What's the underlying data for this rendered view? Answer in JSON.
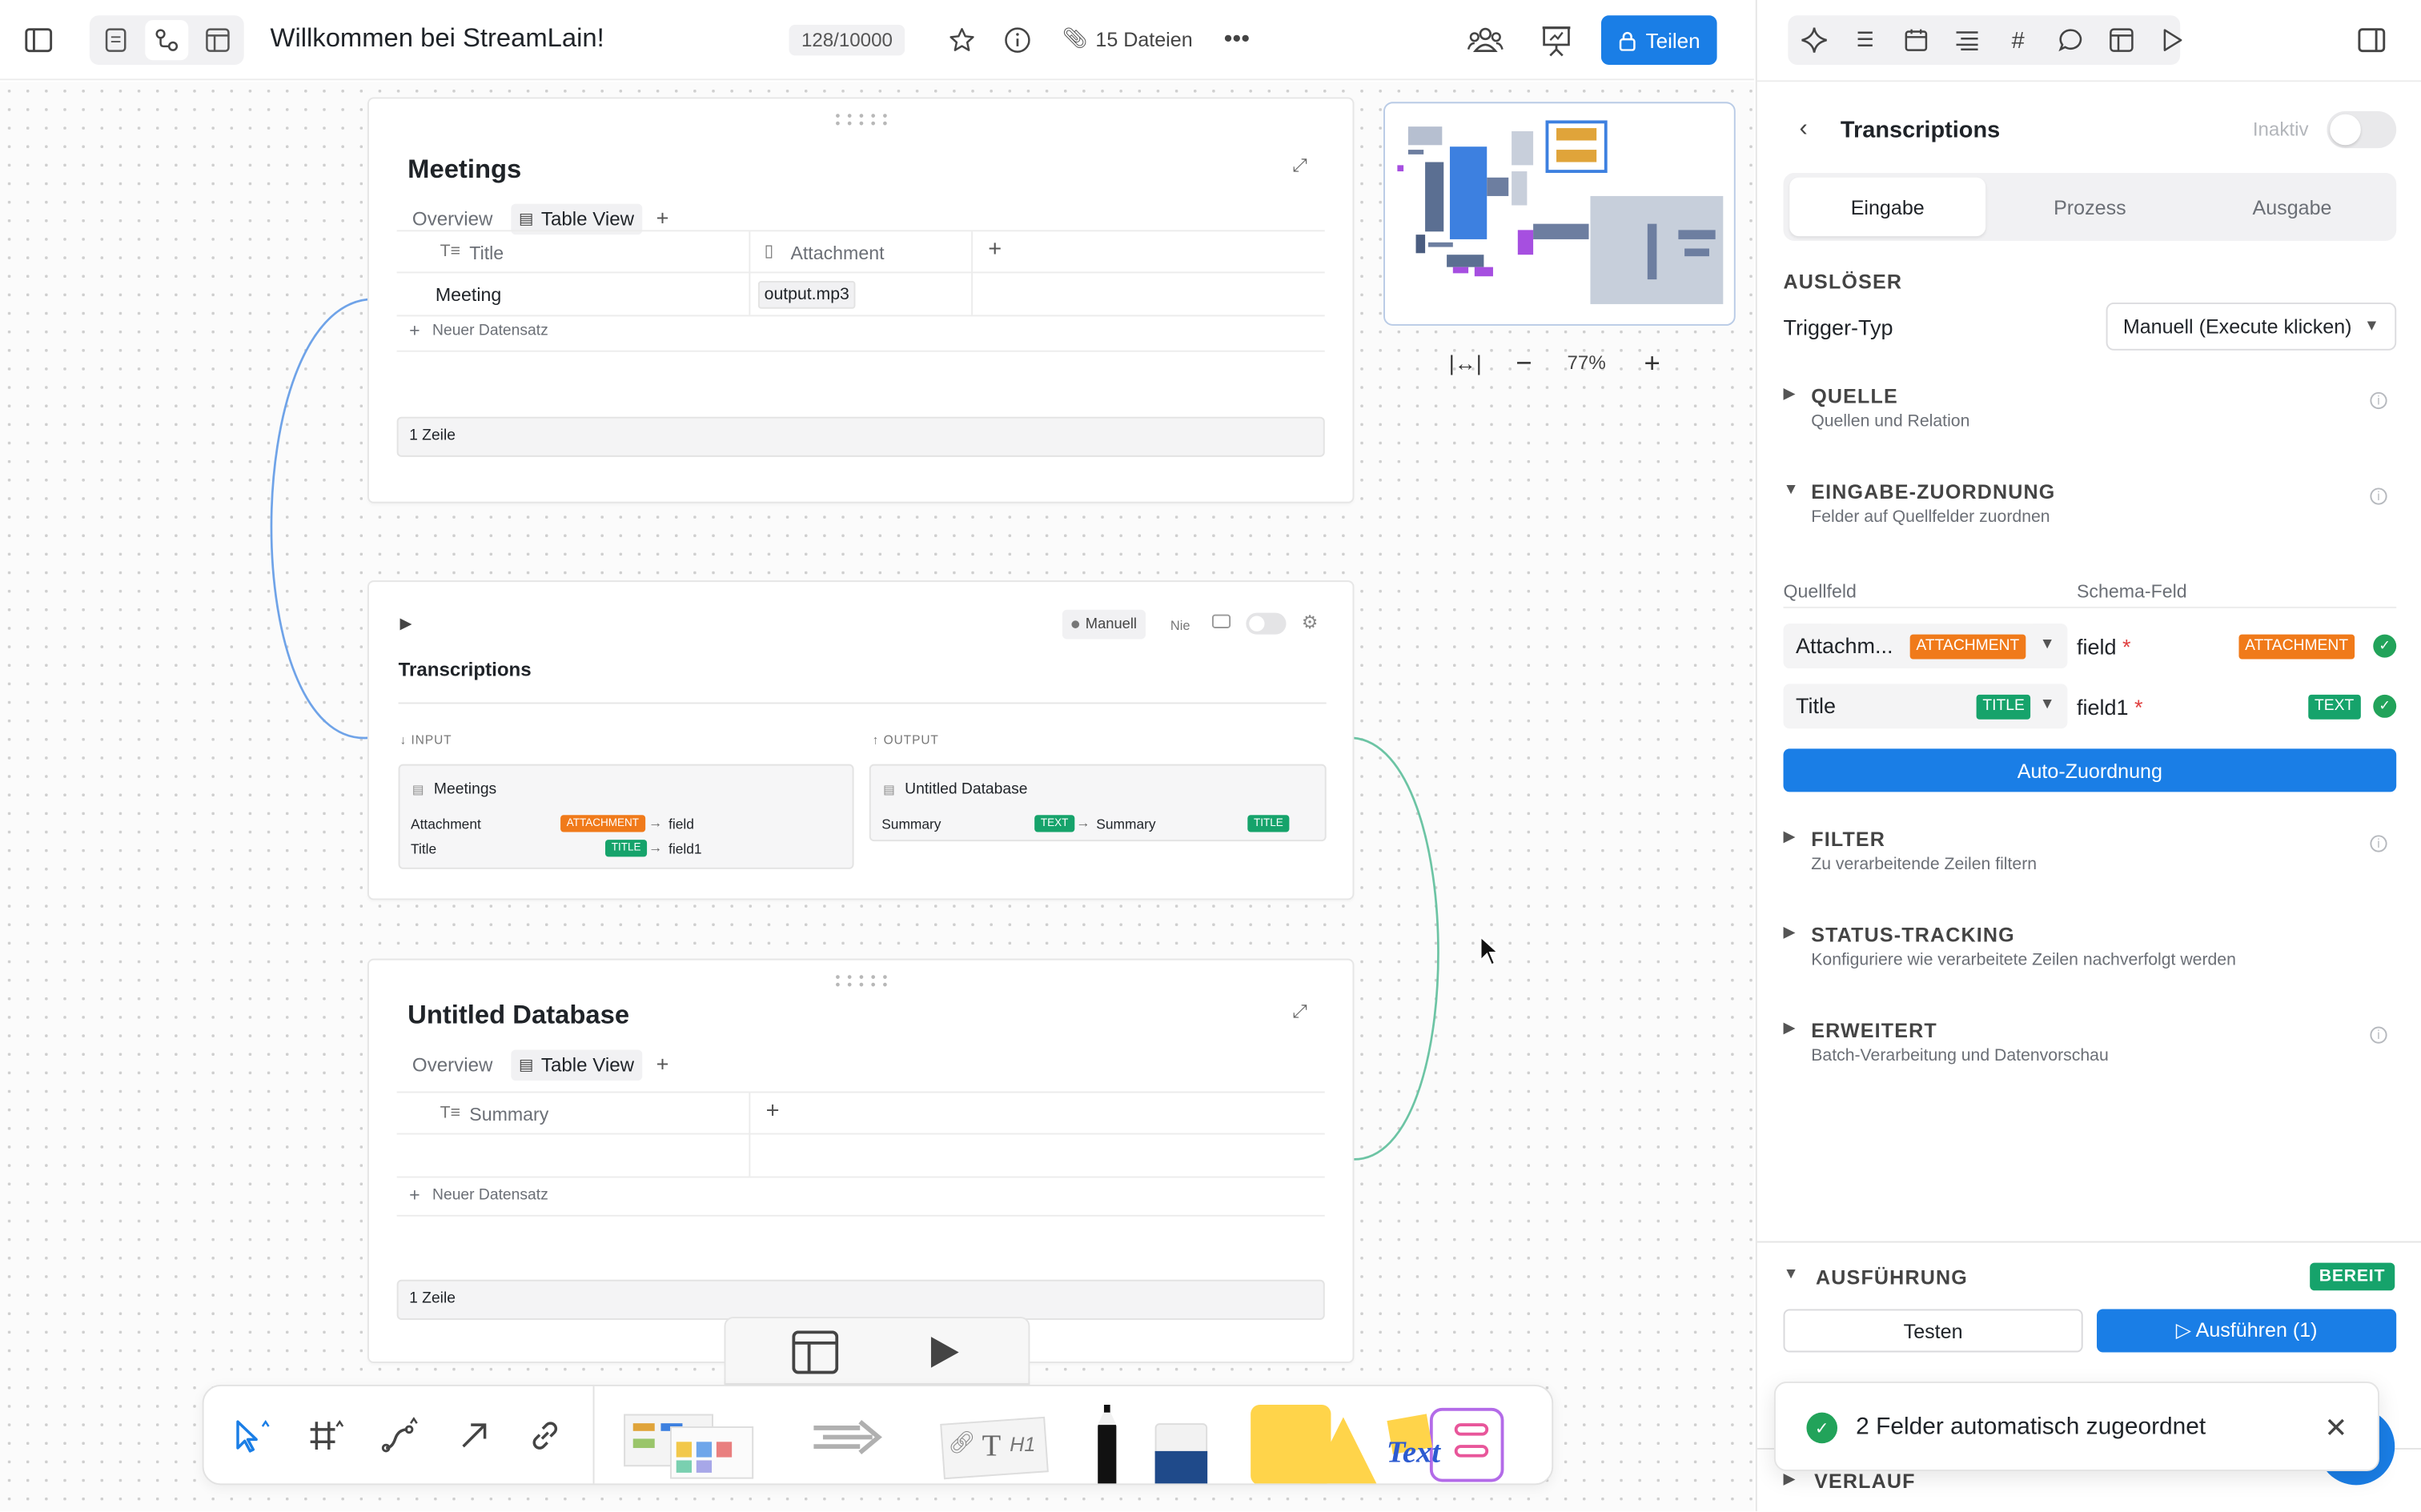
{
  "topbar": {
    "title": "Willkommen bei StreamLain!",
    "counter": "128/10000",
    "files": "15 Dateien",
    "share_label": "Teilen"
  },
  "minimap": {
    "zoom": "77%"
  },
  "meetings_card": {
    "title": "Meetings",
    "tabs": [
      "Overview",
      "Table View"
    ],
    "columns": [
      "Title",
      "Attachment"
    ],
    "row": {
      "title": "Meeting",
      "attachment": "output.mp3"
    },
    "new_record": "Neuer Datensatz",
    "footer": "1 Zeile"
  },
  "transcriptions_card": {
    "title": "Transcriptions",
    "mode": "Manuell",
    "schedule": "Nie",
    "input_label": "INPUT",
    "output_label": "OUTPUT",
    "input_db": "Meetings",
    "input_rows": [
      {
        "field": "Attachment",
        "tag": "ATTACHMENT",
        "target": "field"
      },
      {
        "field": "Title",
        "tag": "TITLE",
        "target": "field1"
      }
    ],
    "output_db": "Untitled Database",
    "output_row": {
      "field": "Summary",
      "tag": "TEXT",
      "target": "Summary",
      "target_tag": "TITLE"
    }
  },
  "untitled_card": {
    "title": "Untitled Database",
    "tabs": [
      "Overview",
      "Table View"
    ],
    "columns": [
      "Summary"
    ],
    "new_record": "Neuer Datensatz",
    "footer": "1 Zeile"
  },
  "panel": {
    "back_title": "Transcriptions",
    "status": "Inaktiv",
    "tabs": [
      "Eingabe",
      "Prozess",
      "Ausgabe"
    ],
    "trigger_heading": "AUSLÖSER",
    "trigger_label": "Trigger-Typ",
    "trigger_value": "Manuell (Execute klicken)",
    "sections": [
      {
        "title": "QUELLE",
        "sub": "Quellen und Relation"
      },
      {
        "title": "EINGABE-ZUORDNUNG",
        "sub": "Felder auf Quellfelder zuordnen"
      }
    ],
    "mapping_headers": {
      "source": "Quellfeld",
      "schema": "Schema-Feld"
    },
    "mappings": [
      {
        "source": "Attachm...",
        "source_tag": "ATTACHMENT",
        "target": "field",
        "target_tag": "ATTACHMENT"
      },
      {
        "source": "Title",
        "source_tag": "TITLE",
        "target": "field1",
        "target_tag": "TEXT"
      }
    ],
    "auto_map": "Auto-Zuordnung",
    "lower_sections": [
      {
        "title": "FILTER",
        "sub": "Zu verarbeitende Zeilen filtern"
      },
      {
        "title": "STATUS-TRACKING",
        "sub": "Konfiguriere wie verarbeitete Zeilen nachverfolgt werden"
      },
      {
        "title": "ERWEITERT",
        "sub": "Batch-Verarbeitung und Datenvorschau"
      }
    ],
    "execution_title": "AUSFÜHRUNG",
    "execution_status": "BEREIT",
    "test_label": "Testen",
    "run_label": "▷ Ausführen (1)",
    "history_title": "VERLAUF"
  },
  "toast": {
    "message": "2 Felder automatisch zugeordnet"
  },
  "colors": {
    "accent": "#1a7ee6",
    "orange": "#f07a1a",
    "green": "#16a36b"
  }
}
